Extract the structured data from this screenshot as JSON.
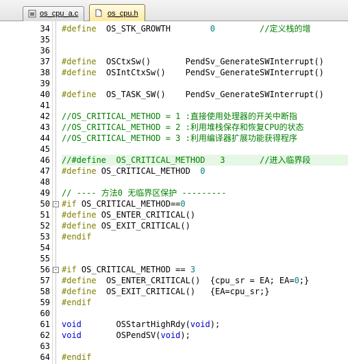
{
  "tabs": [
    {
      "label": "os_cpu_a.c",
      "icon": "asm-file-icon",
      "active": false
    },
    {
      "label": "os_cpu.h",
      "icon": "header-file-icon",
      "active": true
    }
  ],
  "colors": {
    "preprocessor": "#808000",
    "keyword": "#0000cc",
    "comment": "#008000",
    "number": "#008080",
    "line_highlight": "#e6f7e6",
    "active_tab": "#ffe89a"
  },
  "lines": [
    {
      "n": "34",
      "segs": [
        [
          "pp",
          "#define"
        ],
        [
          "tx",
          "  OS_STK_GROWTH        "
        ],
        [
          "num",
          "0"
        ],
        [
          "cm",
          "         //定义栈的增"
        ]
      ]
    },
    {
      "n": "35",
      "segs": []
    },
    {
      "n": "36",
      "segs": []
    },
    {
      "n": "37",
      "segs": [
        [
          "pp",
          "#define"
        ],
        [
          "tx",
          "  OSCtxSw()       PendSv_GenerateSWInterrupt()"
        ]
      ]
    },
    {
      "n": "38",
      "segs": [
        [
          "pp",
          "#define"
        ],
        [
          "tx",
          "  OSIntCtxSw()    PendSv_GenerateSWInterrupt()"
        ]
      ]
    },
    {
      "n": "39",
      "segs": []
    },
    {
      "n": "40",
      "segs": [
        [
          "pp",
          "#define"
        ],
        [
          "tx",
          "  OS_TASK_SW()    PendSv_GenerateSWInterrupt()"
        ]
      ]
    },
    {
      "n": "41",
      "segs": []
    },
    {
      "n": "42",
      "segs": [
        [
          "cm",
          "//OS_CRITICAL_METHOD = 1 :直接使用处理器的开关中断指"
        ]
      ]
    },
    {
      "n": "43",
      "segs": [
        [
          "cm",
          "//OS_CRITICAL_METHOD = 2 :利用堆栈保存和恢复CPU的状态"
        ]
      ]
    },
    {
      "n": "44",
      "segs": [
        [
          "cm",
          "//OS_CRITICAL_METHOD = 3 :利用编译器扩展功能获得程序"
        ]
      ]
    },
    {
      "n": "45",
      "segs": []
    },
    {
      "n": "46",
      "segs": [
        [
          "cm",
          "//#define  OS_CRITICAL_METHOD   3       //进入临界段"
        ]
      ],
      "highlight": true
    },
    {
      "n": "47",
      "segs": [
        [
          "pp",
          "#define"
        ],
        [
          "tx",
          " OS_CRITICAL_METHOD  "
        ],
        [
          "num",
          "0"
        ]
      ]
    },
    {
      "n": "48",
      "segs": []
    },
    {
      "n": "49",
      "segs": [
        [
          "cm",
          "// ---- 方法0 无临界区保护 ---------"
        ]
      ]
    },
    {
      "n": "50",
      "segs": [
        [
          "pp",
          "#if"
        ],
        [
          "tx",
          " OS_CRITICAL_METHOD=="
        ],
        [
          "num",
          "0"
        ]
      ],
      "fold": "-"
    },
    {
      "n": "51",
      "segs": [
        [
          "pp",
          "#define"
        ],
        [
          "tx",
          " OS_ENTER_CRITICAL()"
        ]
      ]
    },
    {
      "n": "52",
      "segs": [
        [
          "pp",
          "#define"
        ],
        [
          "tx",
          " OS_EXIT_CRITICAL()"
        ]
      ]
    },
    {
      "n": "53",
      "segs": [
        [
          "pp",
          "#endif"
        ]
      ]
    },
    {
      "n": "54",
      "segs": []
    },
    {
      "n": "55",
      "segs": []
    },
    {
      "n": "56",
      "segs": [
        [
          "pp",
          "#if"
        ],
        [
          "tx",
          " OS_CRITICAL_METHOD == "
        ],
        [
          "num",
          "3"
        ]
      ],
      "fold": "-"
    },
    {
      "n": "57",
      "segs": [
        [
          "pp",
          "#define"
        ],
        [
          "tx",
          "  OS_ENTER_CRITICAL()  {cpu_sr = EA; EA="
        ],
        [
          "num",
          "0"
        ],
        [
          "tx",
          ";}"
        ]
      ]
    },
    {
      "n": "58",
      "segs": [
        [
          "pp",
          "#define"
        ],
        [
          "tx",
          "  OS_EXIT_CRITICAL()   {EA=cpu_sr;}"
        ]
      ]
    },
    {
      "n": "59",
      "segs": [
        [
          "pp",
          "#endif"
        ]
      ]
    },
    {
      "n": "60",
      "segs": []
    },
    {
      "n": "61",
      "segs": [
        [
          "kw",
          "void"
        ],
        [
          "tx",
          "       OSStartHighRdy("
        ],
        [
          "kw",
          "void"
        ],
        [
          "tx",
          ");"
        ]
      ]
    },
    {
      "n": "62",
      "segs": [
        [
          "kw",
          "void"
        ],
        [
          "tx",
          "       OSPendSV("
        ],
        [
          "kw",
          "void"
        ],
        [
          "tx",
          ");"
        ]
      ]
    },
    {
      "n": "63",
      "segs": []
    },
    {
      "n": "64",
      "segs": [
        [
          "pp",
          "#endif"
        ]
      ]
    }
  ]
}
